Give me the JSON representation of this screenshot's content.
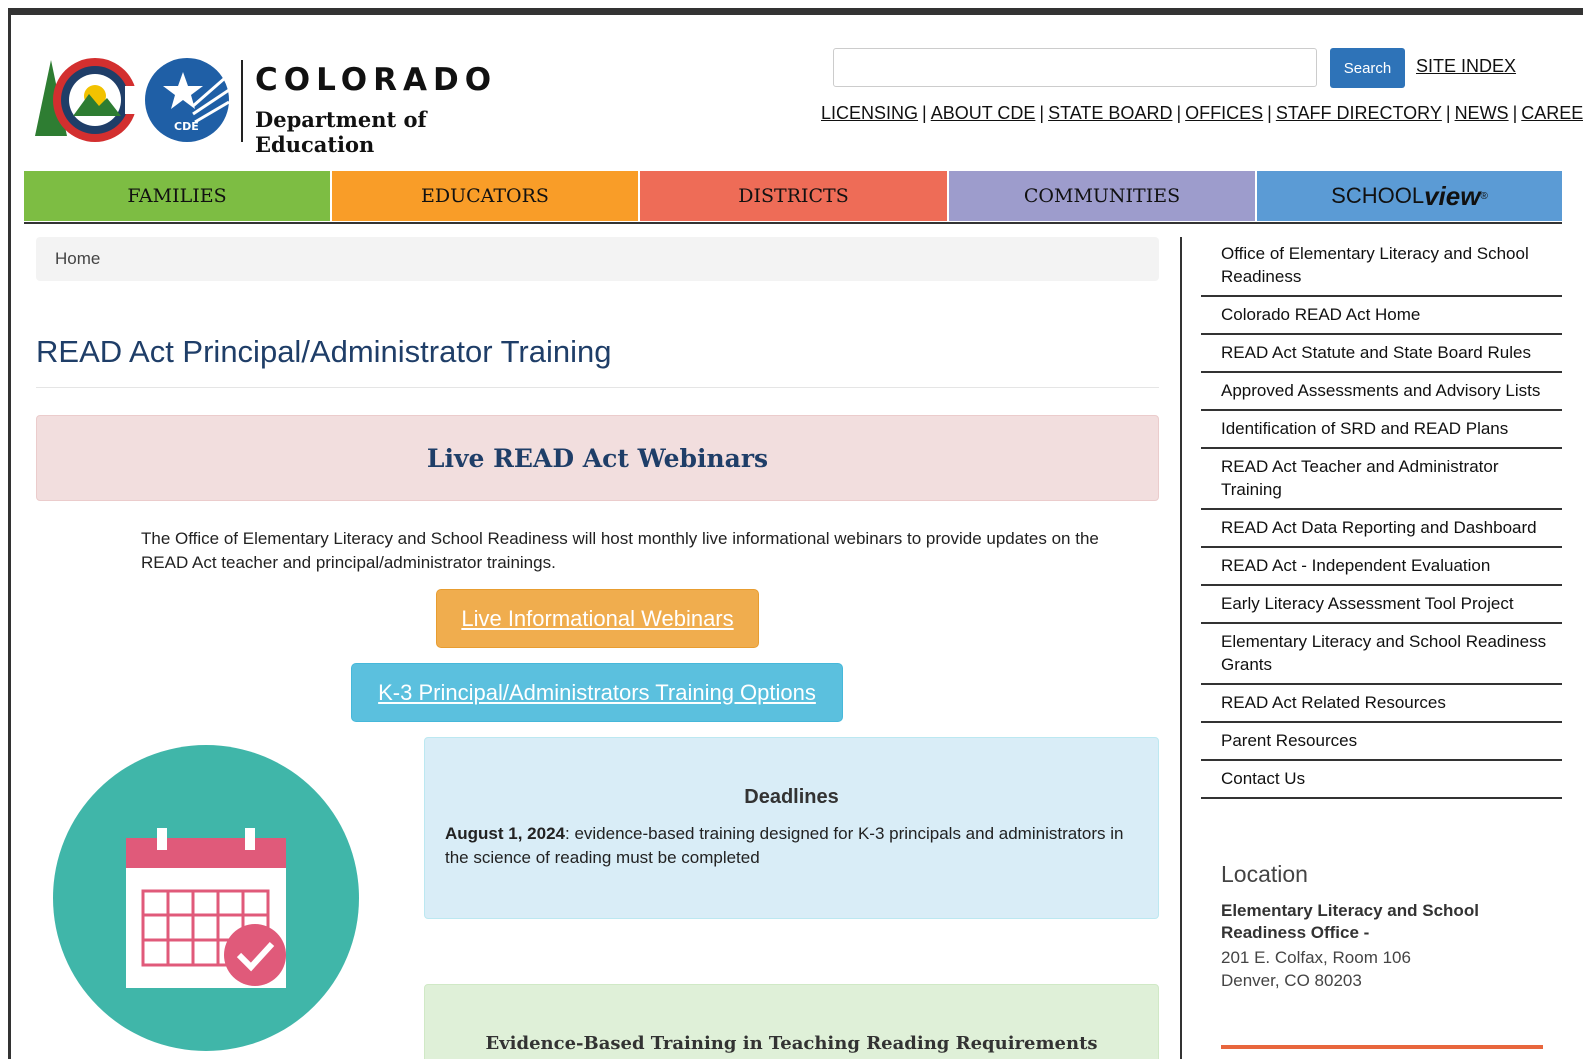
{
  "header": {
    "org_name_line1": "COLORADO",
    "org_name_line2": "Department of Education",
    "logo_badge": "CDE",
    "search_placeholder": "",
    "search_button": "Search",
    "site_index": "SITE INDEX",
    "utility_links": [
      "LICENSING",
      "ABOUT CDE",
      "STATE BOARD",
      "OFFICES",
      "STAFF DIRECTORY",
      "NEWS",
      "CAREERS"
    ]
  },
  "nav": {
    "families": "FAMILIES",
    "educators": "EDUCATORS",
    "districts": "DISTRICTS",
    "communities": "COMMUNITIES",
    "schoolview_a": "SCHOOL",
    "schoolview_b": "view",
    "schoolview_mark": "®"
  },
  "breadcrumb": {
    "home": "Home"
  },
  "main": {
    "title": "READ Act Principal/Administrator Training",
    "alert_heading": "Live READ Act Webinars",
    "intro": "The Office of Elementary Literacy and School Readiness will host monthly live informational webinars to provide updates on the READ Act teacher and principal/administrator trainings.",
    "button_webinars": "Live Informational Webinars",
    "button_training": "K-3 Principal/Administrators Training Options",
    "deadlines_heading": "Deadlines",
    "deadline_date": "August 1, 2024",
    "deadline_text": ": evidence-based training designed for K-3 principals and administrators in the science of reading must be completed",
    "requirements_heading": "Evidence-Based Training in Teaching Reading Requirements"
  },
  "sidebar": {
    "items": [
      "Office of Elementary Literacy and School Readiness",
      "Colorado READ Act Home",
      "READ Act Statute and State Board Rules",
      "Approved Assessments and Advisory Lists",
      "Identification of SRD and READ Plans",
      "READ Act Teacher and Administrator Training",
      "READ Act Data Reporting and Dashboard",
      "READ Act - Independent Evaluation",
      "Early Literacy Assessment Tool Project",
      "Elementary Literacy and School Readiness Grants",
      "READ Act Related Resources",
      "Parent Resources",
      "Contact Us"
    ]
  },
  "location": {
    "title": "Location",
    "office": "Elementary Literacy and School Readiness Office -",
    "street": "201 E. Colfax, Room 106",
    "city": "Denver, CO 80203"
  },
  "colors": {
    "families": "#7dbd43",
    "educators": "#f99d28",
    "districts": "#ee6c57",
    "communities": "#9d9ccc",
    "schoolview": "#5b9bd5",
    "title_blue": "#1f3e68",
    "search_button": "#2e73b8"
  }
}
